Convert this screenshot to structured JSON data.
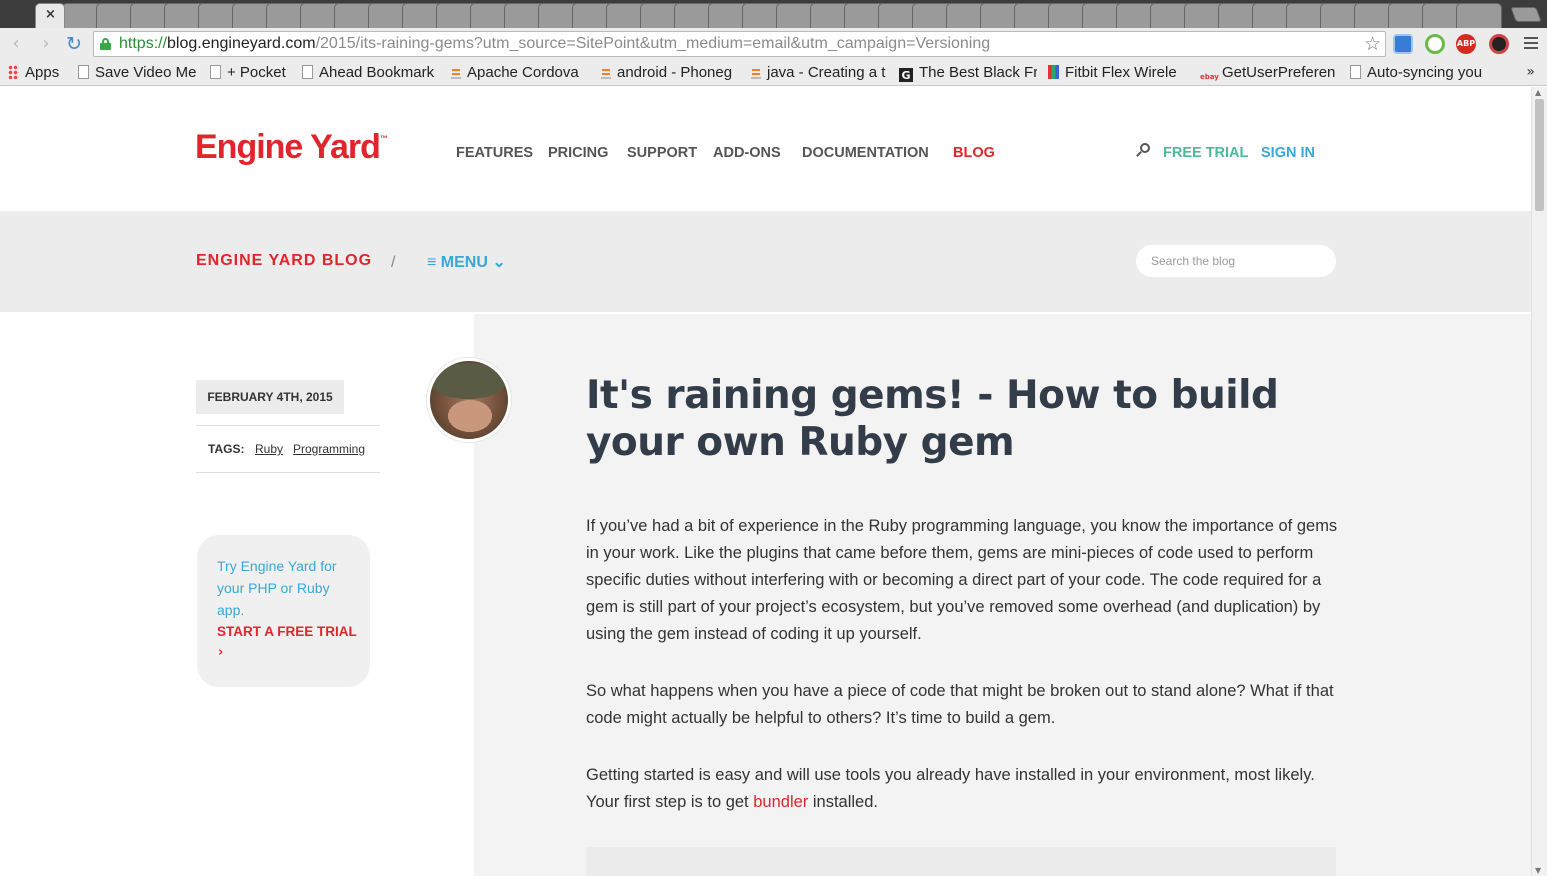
{
  "browser": {
    "tab_close": "×",
    "url_scheme": "https://",
    "url_host": "blog.engineyard.com",
    "url_path": "/2015/its-raining-gems?utm_source=SitePoint&utm_medium=email&utm_campaign=Versioning",
    "ext_abp_label": "ABP",
    "bookmarks": [
      {
        "label": "Apps",
        "icon": "apps-grid-icon"
      },
      {
        "label": "Save Video Me",
        "icon": "page-icon"
      },
      {
        "label": "+ Pocket",
        "icon": "page-icon"
      },
      {
        "label": "Ahead Bookmark",
        "icon": "page-icon"
      },
      {
        "label": "Apache Cordova",
        "icon": "stackoverflow-icon"
      },
      {
        "label": "android - Phoneg",
        "icon": "stackoverflow-icon"
      },
      {
        "label": "java - Creating a t",
        "icon": "stackoverflow-icon"
      },
      {
        "label": "The Best Black Fr",
        "icon": "gizmodo-icon"
      },
      {
        "label": "Fitbit Flex Wirele",
        "icon": "fitbit-icon"
      },
      {
        "label": "GetUserPreferen",
        "icon": "ebay-icon"
      },
      {
        "label": "Auto-syncing you",
        "icon": "page-icon"
      }
    ],
    "bookmarks_more": "»"
  },
  "header": {
    "logo": "Engine Yard",
    "logo_tm": "™",
    "nav": [
      "FEATURES",
      "PRICING",
      "SUPPORT",
      "ADD-ONS",
      "DOCUMENTATION",
      "BLOG"
    ],
    "free_trial": "FREE TRIAL",
    "sign_in": "SIGN IN"
  },
  "blogbar": {
    "title": "ENGINE YARD BLOG",
    "separator": "/",
    "menu": "≡ MENU ⌄",
    "search_placeholder": "Search the blog"
  },
  "sidebar": {
    "date": "FEBRUARY 4TH, 2015",
    "tags_label": "TAGS:",
    "tags": [
      "Ruby",
      "Programming"
    ],
    "promo_text": "Try Engine Yard for your PHP or Ruby app.",
    "promo_cta": "START A FREE TRIAL",
    "promo_chevron": "›"
  },
  "article": {
    "title": "It's raining gems! - How to build your own Ruby gem",
    "p1": "If you’ve had a bit of experience in the Ruby programming language, you know the importance of gems in your work. Like the plugins that came before them, gems are mini-pieces of code used to perform specific duties without interfering with or becoming a direct part of your code. The code required for a gem is still part of your project’s ecosystem, but you’ve removed some overhead (and duplication) by using the gem instead of coding it up yourself.",
    "p2": "So what happens when you have a piece of code that might be broken out to stand alone? What if that code might actually be helpful to others? It’s time to build a gem.",
    "p3_before": "Getting started is easy and will use tools you already have installed in your environment, most likely. Your first step is to get ",
    "p3_link": "bundler",
    "p3_after": " installed."
  },
  "colors": {
    "brand_red": "#e0262c",
    "link_blue": "#35a9d9",
    "trial_green": "#4db89a",
    "title_navy": "#333d4a"
  }
}
